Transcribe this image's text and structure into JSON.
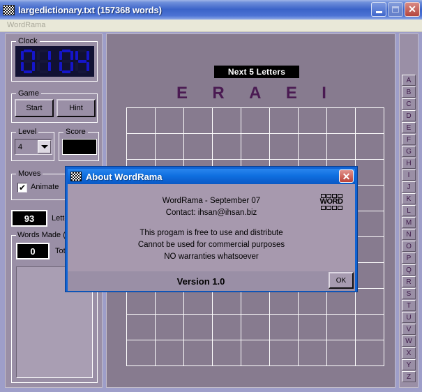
{
  "window": {
    "title": "largedictionary.txt (157368 words)",
    "icon": "checker-grid-icon",
    "controls": {
      "minimize": "minimize-button",
      "maximize": "maximize-button",
      "close": "close-button"
    }
  },
  "menu": {
    "items": [
      {
        "label": "WordRama"
      }
    ]
  },
  "left_panel": {
    "clock": {
      "group_label": "Clock",
      "value": "01:04",
      "digits": [
        "0",
        "1",
        "0",
        "4"
      ]
    },
    "game": {
      "group_label": "Game",
      "start_label": "Start",
      "hint_label": "Hint"
    },
    "level": {
      "group_label": "Level",
      "value": "4"
    },
    "score": {
      "group_label": "Score",
      "value": ""
    },
    "moves": {
      "group_label": "Moves",
      "animate_label": "Animate",
      "animate_checked": "✔",
      "second_checked": "✔"
    },
    "letters_remaining": {
      "value": "93",
      "label": "Letters to"
    },
    "words_made": {
      "group_label": "Words Made (Sc",
      "total_value": "0",
      "total_label": "Total",
      "list_items": []
    }
  },
  "board": {
    "next_letters_banner": "Next 5 Letters",
    "next_letters": [
      "E",
      "R",
      "A",
      "E",
      "I"
    ],
    "grid": {
      "columns": 9,
      "rows": 10
    }
  },
  "alphabet": {
    "letters": [
      "A",
      "B",
      "C",
      "D",
      "E",
      "F",
      "G",
      "H",
      "I",
      "J",
      "K",
      "L",
      "M",
      "N",
      "O",
      "P",
      "Q",
      "R",
      "S",
      "T",
      "U",
      "V",
      "W",
      "X",
      "Y",
      "Z"
    ]
  },
  "about_dialog": {
    "title": "About WordRama",
    "icon": "checker-grid-icon",
    "close_label": "✕",
    "line1": "WordRama - September 07",
    "line2": "Contact: ihsan@ihsan.biz",
    "line3": "This progam is free to use and distribute",
    "line4": "Cannot be used for commercial purposes",
    "line5": "NO warranties whatsoever",
    "logo_text": "WORD",
    "version": "Version 1.0",
    "ok_label": "OK"
  },
  "colors": {
    "title_bar_blue": "#3b63c8",
    "dialog_blue": "#1063d4",
    "panel_mauve": "#9a8fa6",
    "board_mauve": "#877b8f",
    "menu_cream": "#e9e8d8",
    "clock_segment": "#1515c9",
    "letter_purple": "#4a1a52"
  }
}
